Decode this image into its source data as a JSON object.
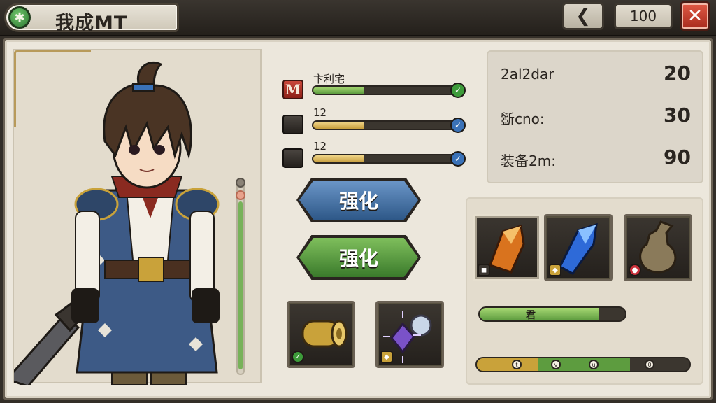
{
  "header": {
    "logo_glyph": "✱",
    "title": "我成MT",
    "back_glyph": "❮",
    "counter": "100",
    "close_glyph": "✕"
  },
  "stats": [
    {
      "label": "卞利宅",
      "fill_pct": 35,
      "icon": "m-badge-icon",
      "icon_text": "M",
      "check": "✓",
      "check_color": "#3d9b3a",
      "bar_color": "green"
    },
    {
      "label": "12",
      "fill_pct": 35,
      "icon": "gear-icon",
      "check": "✓",
      "check_color": "#3a72b8",
      "bar_color": "gold"
    },
    {
      "label": "12",
      "fill_pct": 35,
      "icon": "gear-icon",
      "check": "✓",
      "check_color": "#3a72b8",
      "bar_color": "gold"
    }
  ],
  "buttons": {
    "enhance_blue": "强化",
    "enhance_green": "强化"
  },
  "info": [
    {
      "key": "2al2dar",
      "value": "20"
    },
    {
      "key": "斵cno:",
      "value": "30"
    },
    {
      "key": "装备2m:",
      "value": "90"
    }
  ],
  "items_right": [
    {
      "name": "amber-crystal-icon",
      "badge": "◼",
      "badge_color": "#3a3530"
    },
    {
      "name": "blue-crystal-icon",
      "badge": "◆",
      "badge_color": "#c9a23a"
    },
    {
      "name": "bronze-vase-icon",
      "badge": "●",
      "badge_color": "#c9303a"
    }
  ],
  "items_bottom": [
    {
      "name": "gold-scroll-icon",
      "badge": "✓",
      "badge_color": "#3d9b3a"
    },
    {
      "name": "purple-orb-icon",
      "badge": "◆",
      "badge_color": "#c9a23a"
    }
  ],
  "progress_bar": {
    "label": "君",
    "fill_pct": 82
  },
  "segment_bar": {
    "dots": [
      "t",
      "v",
      "u",
      "0"
    ],
    "fill_pct": 72
  },
  "colors": {
    "accent_green": "#5d9c3f",
    "accent_blue": "#2e5888",
    "close_red": "#c0392b"
  }
}
